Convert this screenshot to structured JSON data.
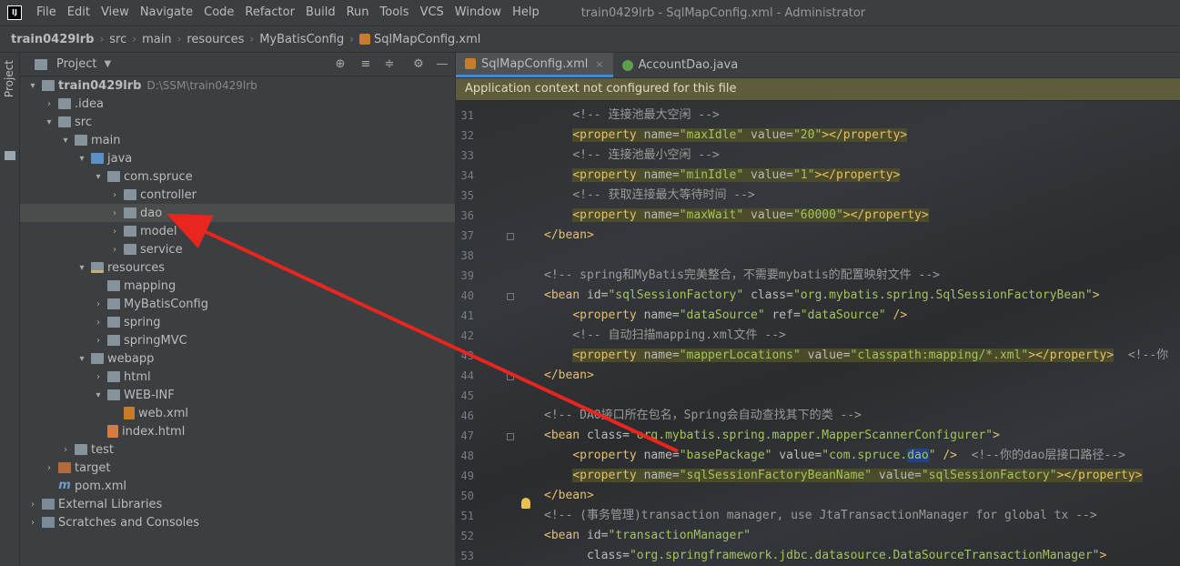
{
  "app": {
    "logo": "IJ",
    "menu": [
      "File",
      "Edit",
      "View",
      "Navigate",
      "Code",
      "Refactor",
      "Build",
      "Run",
      "Tools",
      "VCS",
      "Window",
      "Help"
    ],
    "window_title": "train0429lrb - SqlMapConfig.xml - Administrator"
  },
  "breadcrumb": [
    "train0429lrb",
    "src",
    "main",
    "resources",
    "MyBatisConfig",
    "SqlMapConfig.xml"
  ],
  "left_strip": {
    "label": "Project"
  },
  "project_panel": {
    "title": "Project",
    "tools": [
      "crosshair-icon",
      "expand-icon",
      "collapse-icon",
      "gear-icon",
      "minimize-icon"
    ],
    "tree": [
      {
        "label": "train0429lrb",
        "path": "D:\\SSM\\train0429lrb",
        "chevron": "▾",
        "icon": "folder",
        "bold": true
      },
      {
        "label": ".idea",
        "chevron": "›",
        "icon": "folder"
      },
      {
        "label": "src",
        "chevron": "▾",
        "icon": "folder"
      },
      {
        "label": "main",
        "chevron": "▾",
        "icon": "folder"
      },
      {
        "label": "java",
        "chevron": "▾",
        "icon": "folder-blue"
      },
      {
        "label": "com.spruce",
        "chevron": "▾",
        "icon": "folder"
      },
      {
        "label": "controller",
        "chevron": "›",
        "icon": "folder"
      },
      {
        "label": "dao",
        "chevron": "›",
        "icon": "folder",
        "selected": true
      },
      {
        "label": "model",
        "chevron": "›",
        "icon": "folder"
      },
      {
        "label": "service",
        "chevron": "›",
        "icon": "folder"
      },
      {
        "label": "resources",
        "chevron": "▾",
        "icon": "folder-res"
      },
      {
        "label": "mapping",
        "chevron": "",
        "icon": "folder"
      },
      {
        "label": "MyBatisConfig",
        "chevron": "›",
        "icon": "folder"
      },
      {
        "label": "spring",
        "chevron": "›",
        "icon": "folder"
      },
      {
        "label": "springMVC",
        "chevron": "›",
        "icon": "folder"
      },
      {
        "label": "webapp",
        "chevron": "▾",
        "icon": "folder"
      },
      {
        "label": "html",
        "chevron": "›",
        "icon": "folder"
      },
      {
        "label": "WEB-INF",
        "chevron": "▾",
        "icon": "folder"
      },
      {
        "label": "web.xml",
        "chevron": "",
        "icon": "file-xml"
      },
      {
        "label": "index.html",
        "chevron": "",
        "icon": "file-html"
      },
      {
        "label": "test",
        "chevron": "›",
        "icon": "folder"
      },
      {
        "label": "target",
        "chevron": "›",
        "icon": "folder-orange"
      },
      {
        "label": "pom.xml",
        "chevron": "",
        "icon": "file-m"
      },
      {
        "label": "External Libraries",
        "chevron": "›",
        "icon": "lib-icon"
      },
      {
        "label": "Scratches and Consoles",
        "chevron": "›",
        "icon": "lib-icon"
      }
    ]
  },
  "editor": {
    "tabs": [
      {
        "label": "SqlMapConfig.xml",
        "active": true,
        "icon": "xml-icon",
        "close": "×"
      },
      {
        "label": "AccountDao.java",
        "active": false,
        "icon": "java-icon",
        "close": ""
      }
    ],
    "banner": "Application context not configured for this file",
    "lines": [
      {
        "no": "31",
        "tokens": [
          [
            "    ",
            ""
          ],
          [
            "<!-- 连接池最大空闲 -->",
            "cmt"
          ]
        ]
      },
      {
        "no": "32",
        "tokens": [
          [
            "    ",
            ""
          ],
          [
            "<property ",
            "tag"
          ],
          [
            "name=",
            "attr"
          ],
          [
            "\"maxIdle\"",
            "val"
          ],
          [
            " value=",
            "attr"
          ],
          [
            "\"20\"",
            "val"
          ],
          [
            "></property>",
            "tag"
          ]
        ],
        "hl": true
      },
      {
        "no": "33",
        "tokens": [
          [
            "    ",
            ""
          ],
          [
            "<!-- 连接池最小空闲 -->",
            "cmt"
          ]
        ]
      },
      {
        "no": "34",
        "tokens": [
          [
            "    ",
            ""
          ],
          [
            "<property ",
            "tag"
          ],
          [
            "name=",
            "attr"
          ],
          [
            "\"minIdle\"",
            "val"
          ],
          [
            " value=",
            "attr"
          ],
          [
            "\"1\"",
            "val"
          ],
          [
            "></property>",
            "tag"
          ]
        ],
        "hl": true
      },
      {
        "no": "35",
        "tokens": [
          [
            "    ",
            ""
          ],
          [
            "<!-- 获取连接最大等待时间 -->",
            "cmt"
          ]
        ]
      },
      {
        "no": "36",
        "tokens": [
          [
            "    ",
            ""
          ],
          [
            "<property ",
            "tag"
          ],
          [
            "name=",
            "attr"
          ],
          [
            "\"maxWait\"",
            "val"
          ],
          [
            " value=",
            "attr"
          ],
          [
            "\"60000\"",
            "val"
          ],
          [
            "></property>",
            "tag"
          ]
        ],
        "hl": true
      },
      {
        "no": "37",
        "tokens": [
          [
            "</bean>",
            "tag"
          ]
        ]
      },
      {
        "no": "38",
        "tokens": []
      },
      {
        "no": "39",
        "tokens": [
          [
            "<!-- spring和MyBatis完美整合，不需要mybatis的配置映射文件 -->",
            "cmt"
          ]
        ]
      },
      {
        "no": "40",
        "tokens": [
          [
            "<bean ",
            "tag"
          ],
          [
            "id=",
            "attr"
          ],
          [
            "\"sqlSessionFactory\"",
            "val"
          ],
          [
            " class=",
            "attr"
          ],
          [
            "\"org.mybatis.spring.SqlSessionFactoryBean\"",
            "val"
          ],
          [
            ">",
            "tag"
          ]
        ]
      },
      {
        "no": "41",
        "tokens": [
          [
            "    ",
            ""
          ],
          [
            "<property ",
            "tag"
          ],
          [
            "name=",
            "attr"
          ],
          [
            "\"dataSource\"",
            "val"
          ],
          [
            " ref=",
            "attr"
          ],
          [
            "\"dataSource\"",
            "val"
          ],
          [
            " />",
            "tag"
          ]
        ]
      },
      {
        "no": "42",
        "tokens": [
          [
            "    ",
            ""
          ],
          [
            "<!-- 自动扫描mapping.xml文件 -->",
            "cmt"
          ]
        ]
      },
      {
        "no": "43",
        "tokens": [
          [
            "    ",
            ""
          ],
          [
            "<property ",
            "tag"
          ],
          [
            "name=",
            "attr"
          ],
          [
            "\"mapperLocations\"",
            "val"
          ],
          [
            " value=",
            "attr"
          ],
          [
            "\"classpath:mapping/*.xml\"",
            "val"
          ],
          [
            "></property>",
            "tag"
          ],
          [
            "  <!--你",
            "cmt"
          ]
        ],
        "hl": true
      },
      {
        "no": "44",
        "tokens": [
          [
            "</bean>",
            "tag"
          ]
        ]
      },
      {
        "no": "45",
        "tokens": []
      },
      {
        "no": "46",
        "tokens": [
          [
            "<!-- DAO接口所在包名，Spring会自动查找其下的类 -->",
            "cmt"
          ]
        ]
      },
      {
        "no": "47",
        "tokens": [
          [
            "<bean ",
            "tag"
          ],
          [
            "class=",
            "attr"
          ],
          [
            "\"org.mybatis.spring.mapper.MapperScannerConfigurer\"",
            "val"
          ],
          [
            ">",
            "tag"
          ]
        ]
      },
      {
        "no": "48",
        "tokens": [
          [
            "    ",
            ""
          ],
          [
            "<property ",
            "tag"
          ],
          [
            "name=",
            "attr"
          ],
          [
            "\"basePackage\"",
            "val"
          ],
          [
            " value=",
            "attr"
          ],
          [
            "\"com.spruce.",
            "val"
          ],
          [
            "dao",
            "caret"
          ],
          [
            "\"",
            "val"
          ],
          [
            " />",
            "tag"
          ],
          [
            "  <!--你的dao层接口路径-->",
            "cmt"
          ]
        ]
      },
      {
        "no": "49",
        "tokens": [
          [
            "    ",
            ""
          ],
          [
            "<property ",
            "tag"
          ],
          [
            "name=",
            "attr"
          ],
          [
            "\"sqlSessionFactoryBeanName\"",
            "val"
          ],
          [
            " value=",
            "attr"
          ],
          [
            "\"sqlSessionFactory\"",
            "val"
          ],
          [
            "></property>",
            "tag"
          ]
        ],
        "hl": true
      },
      {
        "no": "50",
        "tokens": [
          [
            "</bean>",
            "tag"
          ]
        ]
      },
      {
        "no": "51",
        "tokens": [
          [
            "<!-- (事务管理)transaction manager, use JtaTransactionManager for global tx -->",
            "cmt"
          ]
        ]
      },
      {
        "no": "52",
        "tokens": [
          [
            "<bean ",
            "tag"
          ],
          [
            "id=",
            "attr"
          ],
          [
            "\"transactionManager\"",
            "val"
          ]
        ]
      },
      {
        "no": "53",
        "tokens": [
          [
            "      ",
            ""
          ],
          [
            "class=",
            "attr"
          ],
          [
            "\"org.springframework.jdbc.datasource.DataSourceTransactionManager\"",
            "val"
          ],
          [
            ">",
            "tag"
          ]
        ]
      }
    ]
  },
  "colors": {
    "arrow": "#e8251f",
    "accent": "#4a88c7"
  }
}
